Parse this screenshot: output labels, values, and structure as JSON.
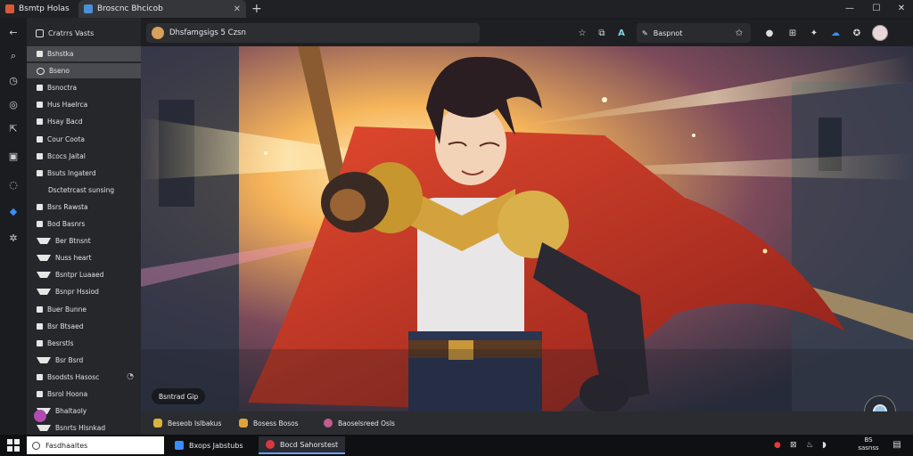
{
  "window": {
    "tabs": [
      {
        "label": "Bsmtp Holas",
        "favicon_color": "#d45a3a"
      },
      {
        "label": "Broscnc Bhcicob",
        "favicon_color": "#4a90d9"
      }
    ],
    "new_tab_glyph": "+",
    "controls": {
      "minimize": "—",
      "maximize": "☐",
      "close": "✕"
    }
  },
  "rail": {
    "icons": [
      {
        "name": "back-arrow-icon",
        "glyph": "←"
      },
      {
        "name": "search-icon",
        "glyph": "⌕"
      },
      {
        "name": "history-icon",
        "glyph": "◷"
      },
      {
        "name": "camera-icon",
        "glyph": "◎"
      },
      {
        "name": "share-icon",
        "glyph": "⇱"
      },
      {
        "name": "collections-icon",
        "glyph": "▣"
      },
      {
        "name": "chat-icon",
        "glyph": "◌"
      },
      {
        "name": "app-icon",
        "glyph": "◆",
        "color": "#3b8cff"
      },
      {
        "name": "settings-icon",
        "glyph": "✲"
      }
    ]
  },
  "sidebar": {
    "header": "Cratrrs Vasts",
    "items": [
      {
        "label": "Bshstka",
        "icon": "square",
        "active": true
      },
      {
        "label": "Bseno",
        "icon": "circle",
        "active": true
      },
      {
        "label": "Bsnoctra",
        "icon": "square"
      },
      {
        "label": "Hus Haelrca",
        "icon": "square"
      },
      {
        "label": "Hsay Bacd",
        "icon": "square"
      },
      {
        "label": "Cour Coota",
        "icon": "square"
      },
      {
        "label": "Bcocs Jaital",
        "icon": "square"
      },
      {
        "label": "Bsuts Ingaterd",
        "icon": "square"
      },
      {
        "label": "Dsctetrcast sunsing",
        "icon": "none",
        "sub": true
      },
      {
        "label": "Bsrs Rawsta",
        "icon": "square"
      },
      {
        "label": "Bod Basnrs",
        "icon": "square"
      },
      {
        "label": "Ber Btnsnt",
        "icon": "tri"
      },
      {
        "label": "Nuss heart",
        "icon": "tri"
      },
      {
        "label": "Bsntpr Luaaed",
        "icon": "tri"
      },
      {
        "label": "Bsnpr Hssiod",
        "icon": "tri"
      },
      {
        "label": "Buer Bunne",
        "icon": "square"
      },
      {
        "label": "Bsr Btsaed",
        "icon": "square"
      },
      {
        "label": "Besrstls",
        "icon": "square"
      },
      {
        "label": "Bsr Bsrd",
        "icon": "tri"
      },
      {
        "label": "Bsodsts Hasosc",
        "icon": "square",
        "trail": "◔"
      },
      {
        "label": "Bsrol Hoona",
        "icon": "square"
      },
      {
        "label": "Bhaltaoly",
        "icon": "tri"
      },
      {
        "label": "Bsnrts Hlsnkad",
        "icon": "tri"
      }
    ]
  },
  "address_bar": {
    "url": "Dhsfamgsigs 5 Czsn",
    "search_label": "Baspnot",
    "toolbar_icons": [
      {
        "name": "star-icon",
        "glyph": "☆"
      },
      {
        "name": "extension-icon",
        "glyph": "⧉"
      },
      {
        "name": "translate-icon",
        "glyph": "A"
      },
      {
        "name": "pen-icon",
        "glyph": "✎"
      },
      {
        "name": "favorite-icon",
        "glyph": "✩"
      },
      {
        "name": "copilot-icon",
        "glyph": "●"
      },
      {
        "name": "collections-icon",
        "glyph": "⊞"
      },
      {
        "name": "reading-icon",
        "glyph": "✦"
      },
      {
        "name": "cloud-icon",
        "glyph": "☁",
        "color": "#3b8cff"
      },
      {
        "name": "copilot-alt-icon",
        "glyph": "✪"
      }
    ]
  },
  "main": {
    "caption": "Bsntrad Gip"
  },
  "bookmarks": [
    {
      "label": "Beseob Islbakus",
      "color": "#d9b43c"
    },
    {
      "label": "Bosess Bosos",
      "color": "#e0a33a"
    },
    {
      "label": "Baoselsreed Osls",
      "color": "#c25c8c"
    }
  ],
  "taskbar": {
    "search_placeholder": "Fasdhaaltes",
    "apps": [
      {
        "label": "Bxops Jabstubs",
        "color": "#3b8cff",
        "active": false
      },
      {
        "label": "Bocd Sahorstest",
        "color": "#d9393f",
        "active": true
      }
    ],
    "tray_icons": [
      {
        "name": "security-icon",
        "glyph": "●",
        "color": "#e23a3a"
      },
      {
        "name": "network-icon",
        "glyph": "⊠"
      },
      {
        "name": "battery-icon",
        "glyph": "♨"
      },
      {
        "name": "volume-icon",
        "glyph": "◗"
      }
    ],
    "clock_time": "BS",
    "clock_date": "sasnss"
  }
}
